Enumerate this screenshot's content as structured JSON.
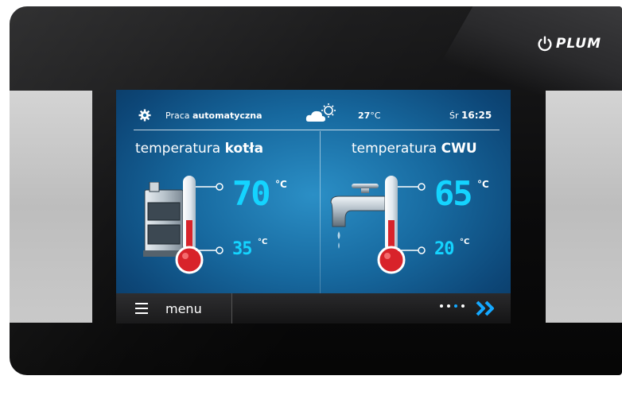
{
  "brand": {
    "logo_text": "PLUM"
  },
  "status": {
    "mode_prefix": "Praca",
    "mode_value": "automatyczna",
    "outdoor_temp": "27",
    "outdoor_unit": "°C",
    "day": "Śr",
    "time": "16:25",
    "weather_icon": "cloud-sun-icon"
  },
  "boiler": {
    "title_prefix": "temperatura",
    "title_value": "kotła",
    "current_temp": "70",
    "set_temp": "35",
    "unit": "°C",
    "icon": "boiler-icon"
  },
  "dhw": {
    "title_prefix": "temperatura",
    "title_value": "CWU",
    "current_temp": "65",
    "set_temp": "20",
    "unit": "°C",
    "icon": "tap-icon"
  },
  "bottom": {
    "menu_label": "menu",
    "page_count": 4,
    "active_page": 3
  },
  "colors": {
    "accent": "#14d4ff",
    "screen_bg": "#17699f",
    "thermometer_red": "#d8232a"
  }
}
